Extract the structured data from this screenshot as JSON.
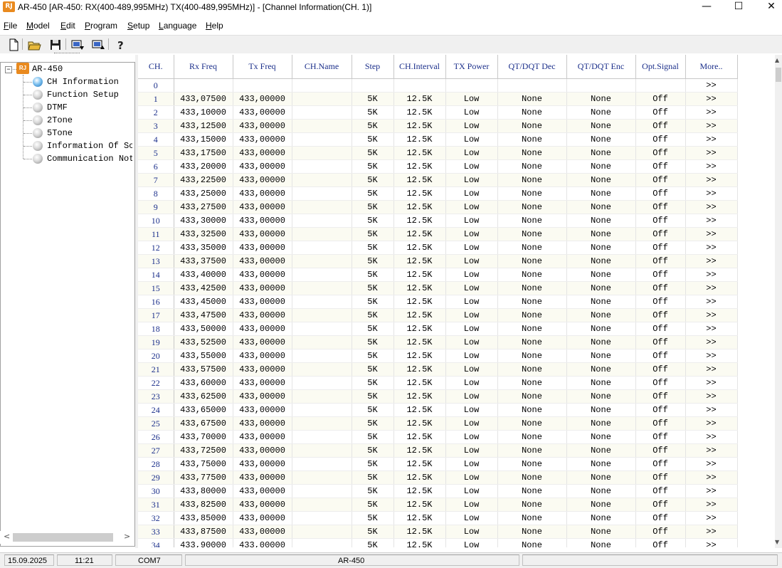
{
  "window": {
    "title": "AR-450  [AR-450: RX(400-489,995MHz) TX(400-489,995MHz)] - [Channel Information(CH. 1)]",
    "icon_label": "RJ",
    "minimize": "—",
    "maximize": "☐",
    "close": "✕"
  },
  "menu": [
    {
      "accel": "F",
      "rest": "ile"
    },
    {
      "accel": "M",
      "rest": "odel"
    },
    {
      "accel": "E",
      "rest": "dit"
    },
    {
      "accel": "P",
      "rest": "rogram"
    },
    {
      "accel": "S",
      "rest": "etup"
    },
    {
      "accel": "L",
      "rest": "anguage"
    },
    {
      "accel": "H",
      "rest": "elp"
    }
  ],
  "toolbar": {
    "icons": [
      "new-file-icon",
      "open-folder-icon",
      "save-disk-icon",
      "read-radio-icon",
      "write-radio-icon",
      "help-question-icon"
    ]
  },
  "tree": {
    "root": "AR-450",
    "root_icon_label": "RJ",
    "expander": "−",
    "items": [
      "CH Information",
      "Function Setup",
      "DTMF",
      "2Tone",
      "5Tone",
      "Information Of Sc",
      "Communication Not"
    ]
  },
  "grid": {
    "columns": [
      "CH.",
      "Rx Freq",
      "Tx Freq",
      "CH.Name",
      "Step",
      "CH.Interval",
      "TX Power",
      "QT/DQT Dec",
      "QT/DQT Enc",
      "Opt.Signal",
      "More.."
    ],
    "rows": [
      [
        "0",
        "",
        "",
        "",
        "",
        "",
        "",
        "",
        "",
        "",
        ">>"
      ],
      [
        "1",
        "433,07500",
        "433,00000",
        "",
        "5K",
        "12.5K",
        "Low",
        "None",
        "None",
        "Off",
        ">>"
      ],
      [
        "2",
        "433,10000",
        "433,00000",
        "",
        "5K",
        "12.5K",
        "Low",
        "None",
        "None",
        "Off",
        ">>"
      ],
      [
        "3",
        "433,12500",
        "433,00000",
        "",
        "5K",
        "12.5K",
        "Low",
        "None",
        "None",
        "Off",
        ">>"
      ],
      [
        "4",
        "433,15000",
        "433,00000",
        "",
        "5K",
        "12.5K",
        "Low",
        "None",
        "None",
        "Off",
        ">>"
      ],
      [
        "5",
        "433,17500",
        "433,00000",
        "",
        "5K",
        "12.5K",
        "Low",
        "None",
        "None",
        "Off",
        ">>"
      ],
      [
        "6",
        "433,20000",
        "433,00000",
        "",
        "5K",
        "12.5K",
        "Low",
        "None",
        "None",
        "Off",
        ">>"
      ],
      [
        "7",
        "433,22500",
        "433,00000",
        "",
        "5K",
        "12.5K",
        "Low",
        "None",
        "None",
        "Off",
        ">>"
      ],
      [
        "8",
        "433,25000",
        "433,00000",
        "",
        "5K",
        "12.5K",
        "Low",
        "None",
        "None",
        "Off",
        ">>"
      ],
      [
        "9",
        "433,27500",
        "433,00000",
        "",
        "5K",
        "12.5K",
        "Low",
        "None",
        "None",
        "Off",
        ">>"
      ],
      [
        "10",
        "433,30000",
        "433,00000",
        "",
        "5K",
        "12.5K",
        "Low",
        "None",
        "None",
        "Off",
        ">>"
      ],
      [
        "11",
        "433,32500",
        "433,00000",
        "",
        "5K",
        "12.5K",
        "Low",
        "None",
        "None",
        "Off",
        ">>"
      ],
      [
        "12",
        "433,35000",
        "433,00000",
        "",
        "5K",
        "12.5K",
        "Low",
        "None",
        "None",
        "Off",
        ">>"
      ],
      [
        "13",
        "433,37500",
        "433,00000",
        "",
        "5K",
        "12.5K",
        "Low",
        "None",
        "None",
        "Off",
        ">>"
      ],
      [
        "14",
        "433,40000",
        "433,00000",
        "",
        "5K",
        "12.5K",
        "Low",
        "None",
        "None",
        "Off",
        ">>"
      ],
      [
        "15",
        "433,42500",
        "433,00000",
        "",
        "5K",
        "12.5K",
        "Low",
        "None",
        "None",
        "Off",
        ">>"
      ],
      [
        "16",
        "433,45000",
        "433,00000",
        "",
        "5K",
        "12.5K",
        "Low",
        "None",
        "None",
        "Off",
        ">>"
      ],
      [
        "17",
        "433,47500",
        "433,00000",
        "",
        "5K",
        "12.5K",
        "Low",
        "None",
        "None",
        "Off",
        ">>"
      ],
      [
        "18",
        "433,50000",
        "433,00000",
        "",
        "5K",
        "12.5K",
        "Low",
        "None",
        "None",
        "Off",
        ">>"
      ],
      [
        "19",
        "433,52500",
        "433,00000",
        "",
        "5K",
        "12.5K",
        "Low",
        "None",
        "None",
        "Off",
        ">>"
      ],
      [
        "20",
        "433,55000",
        "433,00000",
        "",
        "5K",
        "12.5K",
        "Low",
        "None",
        "None",
        "Off",
        ">>"
      ],
      [
        "21",
        "433,57500",
        "433,00000",
        "",
        "5K",
        "12.5K",
        "Low",
        "None",
        "None",
        "Off",
        ">>"
      ],
      [
        "22",
        "433,60000",
        "433,00000",
        "",
        "5K",
        "12.5K",
        "Low",
        "None",
        "None",
        "Off",
        ">>"
      ],
      [
        "23",
        "433,62500",
        "433,00000",
        "",
        "5K",
        "12.5K",
        "Low",
        "None",
        "None",
        "Off",
        ">>"
      ],
      [
        "24",
        "433,65000",
        "433,00000",
        "",
        "5K",
        "12.5K",
        "Low",
        "None",
        "None",
        "Off",
        ">>"
      ],
      [
        "25",
        "433,67500",
        "433,00000",
        "",
        "5K",
        "12.5K",
        "Low",
        "None",
        "None",
        "Off",
        ">>"
      ],
      [
        "26",
        "433,70000",
        "433,00000",
        "",
        "5K",
        "12.5K",
        "Low",
        "None",
        "None",
        "Off",
        ">>"
      ],
      [
        "27",
        "433,72500",
        "433,00000",
        "",
        "5K",
        "12.5K",
        "Low",
        "None",
        "None",
        "Off",
        ">>"
      ],
      [
        "28",
        "433,75000",
        "433,00000",
        "",
        "5K",
        "12.5K",
        "Low",
        "None",
        "None",
        "Off",
        ">>"
      ],
      [
        "29",
        "433,77500",
        "433,00000",
        "",
        "5K",
        "12.5K",
        "Low",
        "None",
        "None",
        "Off",
        ">>"
      ],
      [
        "30",
        "433,80000",
        "433,00000",
        "",
        "5K",
        "12.5K",
        "Low",
        "None",
        "None",
        "Off",
        ">>"
      ],
      [
        "31",
        "433,82500",
        "433,00000",
        "",
        "5K",
        "12.5K",
        "Low",
        "None",
        "None",
        "Off",
        ">>"
      ],
      [
        "32",
        "433,85000",
        "433,00000",
        "",
        "5K",
        "12.5K",
        "Low",
        "None",
        "None",
        "Off",
        ">>"
      ],
      [
        "33",
        "433,87500",
        "433,00000",
        "",
        "5K",
        "12.5K",
        "Low",
        "None",
        "None",
        "Off",
        ">>"
      ],
      [
        "34",
        "433,90000",
        "433,00000",
        "",
        "5K",
        "12.5K",
        "Low",
        "None",
        "None",
        "Off",
        ">>"
      ]
    ]
  },
  "statusbar": {
    "date": "15.09.2025",
    "time": "11:21",
    "port": "COM7",
    "model": "AR-450"
  },
  "colors": {
    "header_text": "#1a2e8a",
    "row_alt": "#fbfbf2",
    "app_icon": "#e98a1f"
  }
}
